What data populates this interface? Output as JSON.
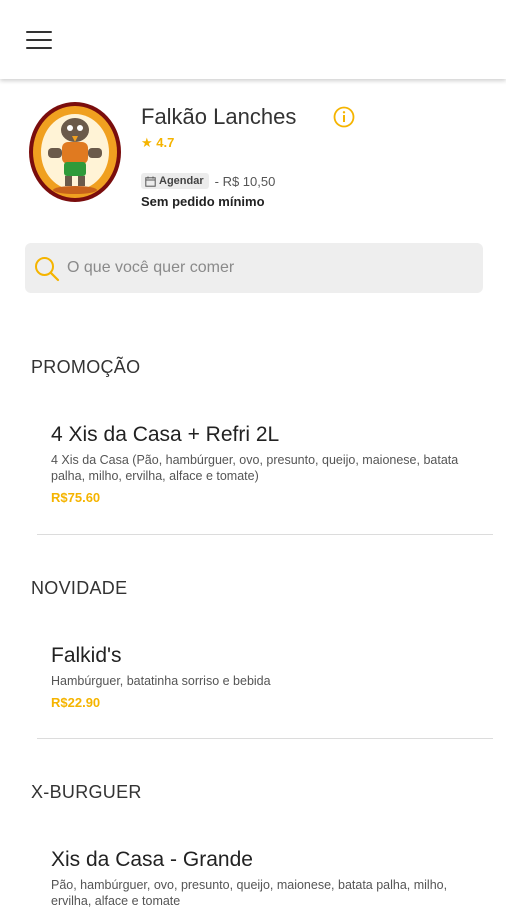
{
  "header": {
    "menu_icon": "hamburger-menu-icon"
  },
  "store": {
    "name": "Falkão Lanches",
    "rating": "4.7",
    "schedule_label": "Agendar",
    "delivery_fee": "- R$ 10,50",
    "min_order": "Sem pedido mínimo",
    "logo_text": "Falkão Lanches"
  },
  "search": {
    "placeholder": "O que você quer comer"
  },
  "colors": {
    "accent": "#f5b400"
  },
  "categories": [
    {
      "name": "PROMOÇÃO",
      "items": [
        {
          "title": "4 Xis da Casa + Refri 2L",
          "description": "4 Xis da Casa (Pão, hambúrguer, ovo, presunto, queijo, maionese, batata palha, milho, ervilha, alface e tomate)",
          "price": "R$75.60"
        }
      ]
    },
    {
      "name": "NOVIDADE",
      "items": [
        {
          "title": "Falkid's",
          "description": "Hambúrguer, batatinha sorriso e bebida",
          "price": "R$22.90"
        }
      ]
    },
    {
      "name": "X-BURGUER",
      "items": [
        {
          "title": "Xis da Casa - Grande",
          "description": "Pão, hambúrguer, ovo, presunto, queijo, maionese, batata palha, milho, ervilha, alface e tomate"
        }
      ]
    }
  ]
}
